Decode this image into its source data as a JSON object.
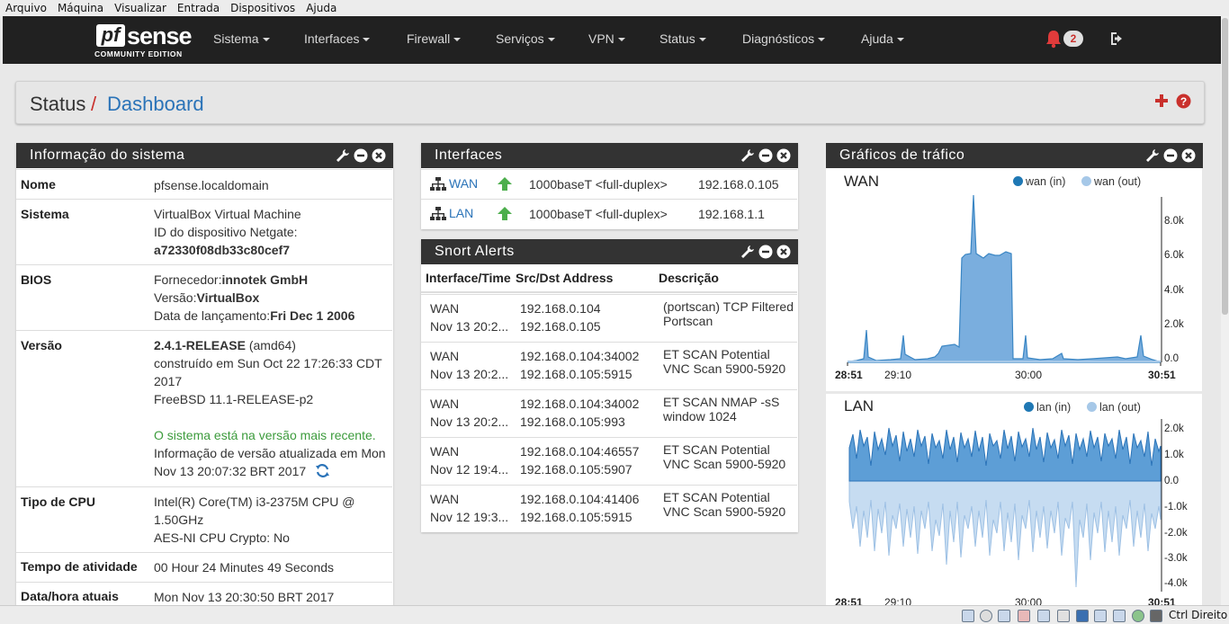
{
  "vbox_menu": [
    "Arquivo",
    "Máquina",
    "Visualizar",
    "Entrada",
    "Dispositivos",
    "Ajuda"
  ],
  "logo": {
    "pf": "pf",
    "sense": "sense",
    "edition": "COMMUNITY EDITION"
  },
  "nav": [
    "Sistema",
    "Interfaces",
    "Firewall",
    "Serviços",
    "VPN",
    "Status",
    "Diagnósticos",
    "Ajuda"
  ],
  "notifications": "2",
  "breadcrumb": {
    "section": "Status",
    "separator": "/",
    "page": "Dashboard"
  },
  "system_info": {
    "title": "Informação do sistema",
    "name_label": "Nome",
    "name": "pfsense.localdomain",
    "system_label": "Sistema",
    "system_line1": "VirtualBox Virtual Machine",
    "system_line2": "ID do dispositivo Netgate:",
    "system_id": "a72330f08db33c80cef7",
    "bios_label": "BIOS",
    "bios_vendor_label": "Fornecedor:",
    "bios_vendor": "innotek GmbH",
    "bios_version_label": "Versão:",
    "bios_version": "VirtualBox",
    "bios_date_label": "Data de lançamento:",
    "bios_date": "Fri Dec 1 2006",
    "version_label": "Versão",
    "version": "2.4.1-RELEASE",
    "version_arch": " (amd64)",
    "built": "construído em Sun Oct 22 17:26:33 CDT",
    "built2": "2017",
    "freebsd": "FreeBSD 11.1-RELEASE-p2",
    "uptodate": "O sistema está na versão mais recente.",
    "updated_info": "Informação de versão atualizada em Mon",
    "updated_info2": "Nov 13 20:07:32 BRT 2017",
    "cpu_label": "Tipo de CPU",
    "cpu1": "Intel(R) Core(TM) i3-2375M CPU @",
    "cpu2": "1.50GHz",
    "cpu3": "AES-NI CPU Crypto: No",
    "uptime_label": "Tempo de atividade",
    "uptime": "00 Hour 24 Minutes 49 Seconds",
    "datetime_label": "Data/hora atuais",
    "datetime": "Mon Nov 13 20:30:50 BRT 2017"
  },
  "interfaces": {
    "title": "Interfaces",
    "rows": [
      {
        "name": "WAN",
        "media": "1000baseT <full-duplex>",
        "ip": "192.168.0.105"
      },
      {
        "name": "LAN",
        "media": "1000baseT <full-duplex>",
        "ip": "192.168.1.1"
      }
    ]
  },
  "snort": {
    "title": "Snort Alerts",
    "headers": [
      "Interface/Time",
      "Src/Dst Address",
      "Descrição"
    ],
    "rows": [
      {
        "iface": "WAN",
        "time": "Nov 13 20:2...",
        "src": "192.168.0.104",
        "dst": "192.168.0.105",
        "desc": "(portscan) TCP Filtered Portscan"
      },
      {
        "iface": "WAN",
        "time": "Nov 13 20:2...",
        "src": "192.168.0.104:34002",
        "dst": "192.168.0.105:5915",
        "desc": "ET SCAN Potential VNC Scan 5900-5920"
      },
      {
        "iface": "WAN",
        "time": "Nov 13 20:2...",
        "src": "192.168.0.104:34002",
        "dst": "192.168.0.105:993",
        "desc": "ET SCAN NMAP -sS window 1024"
      },
      {
        "iface": "WAN",
        "time": "Nov 12 19:4...",
        "src": "192.168.0.104:46557",
        "dst": "192.168.0.105:5907",
        "desc": "ET SCAN Potential VNC Scan 5900-5920"
      },
      {
        "iface": "WAN",
        "time": "Nov 12 19:3...",
        "src": "192.168.0.104:41406",
        "dst": "192.168.0.105:5915",
        "desc": "ET SCAN Potential VNC Scan 5900-5920"
      }
    ]
  },
  "traffic": {
    "title": "Gráficos de tráfico",
    "wan_title": "WAN",
    "wan_in": "wan (in)",
    "wan_out": "wan (out)",
    "lan_title": "LAN",
    "lan_in": "lan (in)",
    "lan_out": "lan (out)",
    "wan_yticks": [
      "8.0k",
      "6.0k",
      "4.0k",
      "2.0k",
      "0.0"
    ],
    "lan_yticks": [
      "2.0k",
      "1.0k",
      "0.0",
      "-1.0k",
      "-2.0k",
      "-3.0k",
      "-4.0k"
    ],
    "xticks": [
      "28:51",
      "29:10",
      "30:00",
      "30:51"
    ],
    "color_in": "#1f78b4",
    "color_out": "#a6c8e8"
  },
  "vbox_status": "Ctrl Direito"
}
